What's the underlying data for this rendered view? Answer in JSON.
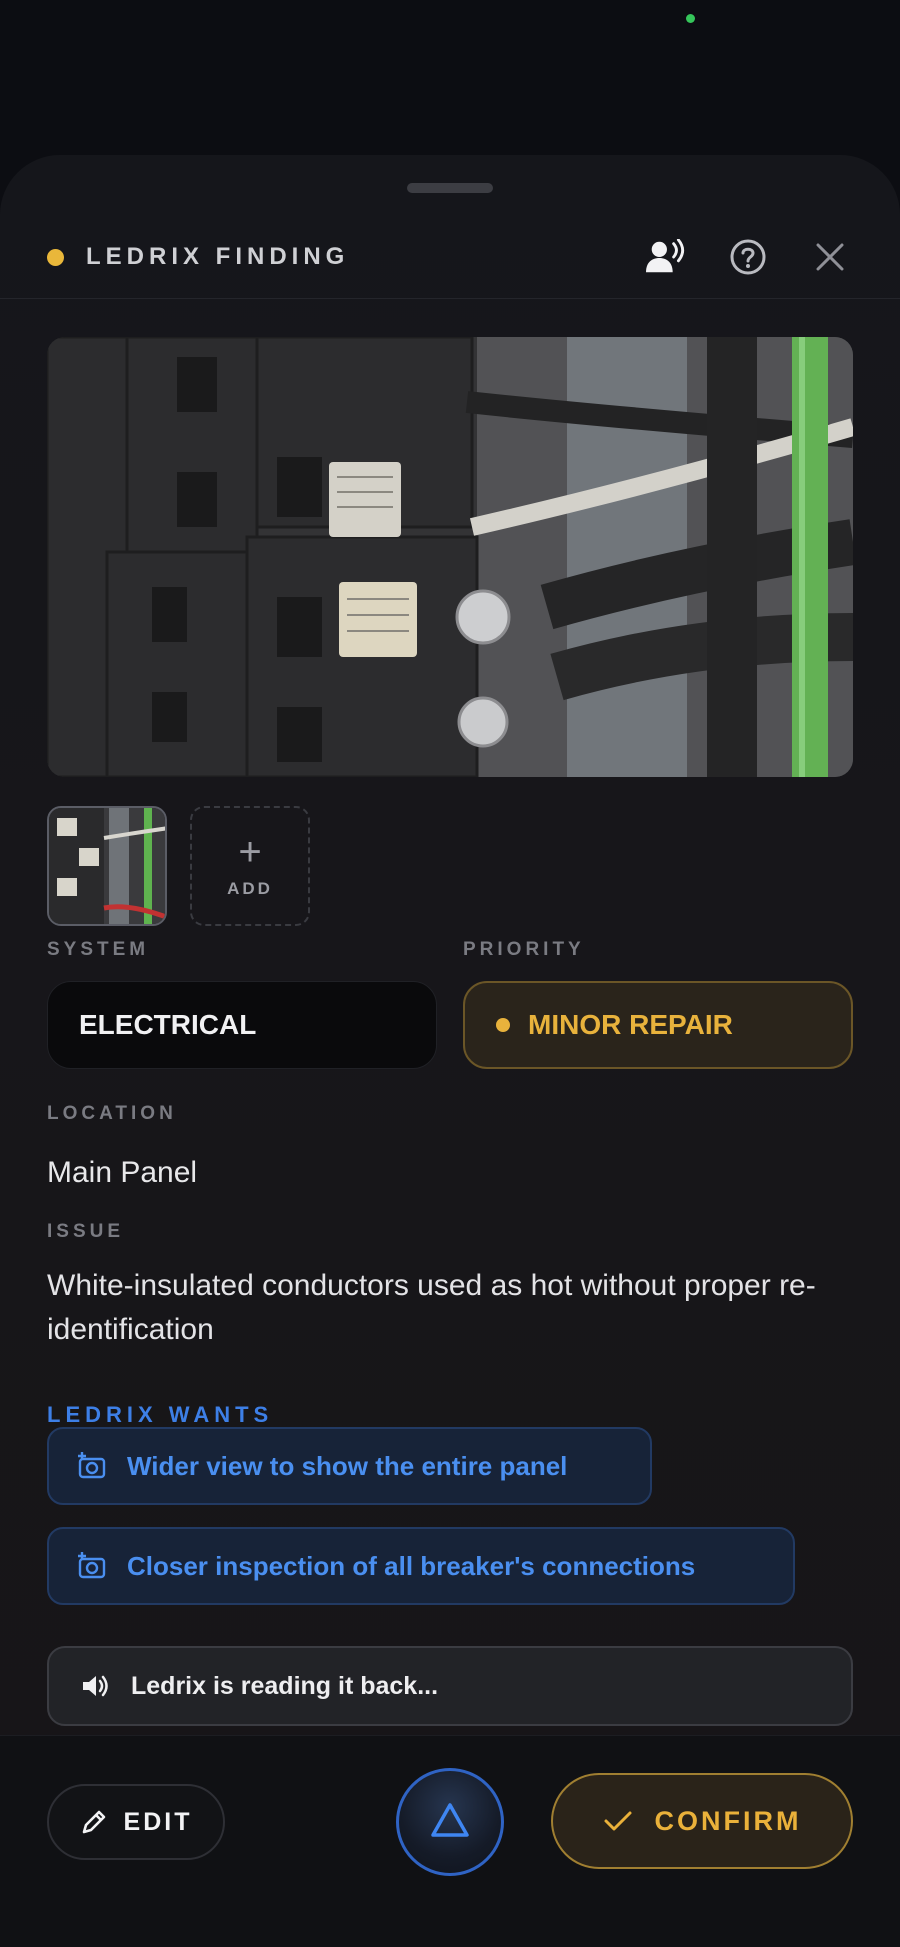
{
  "header": {
    "title": "LEDRIX FINDING",
    "status_color": "#e9b73a"
  },
  "photos": {
    "add_label": "ADD",
    "add_icon": "plus-icon"
  },
  "fields": {
    "system_label": "SYSTEM",
    "system_value": "ELECTRICAL",
    "priority_label": "PRIORITY",
    "priority_value": "MINOR REPAIR",
    "priority_color": "#e8b23c",
    "location_label": "LOCATION",
    "location_value": "Main Panel",
    "issue_label": "ISSUE",
    "issue_value": "White-insulated conductors used as hot without proper re-identification"
  },
  "wants": {
    "label": "LEDRIX WANTS",
    "items": [
      {
        "label": "Wider view to show the entire panel",
        "icon": "camera-add-icon"
      },
      {
        "label": "Closer inspection of all breaker's connections",
        "icon": "camera-add-icon"
      }
    ],
    "accent_color": "#4a8ff0"
  },
  "readback": {
    "text": "Ledrix is reading it back...",
    "icon": "speaker-icon"
  },
  "actions": {
    "edit_label": "EDIT",
    "confirm_label": "CONFIRM",
    "confirm_color": "#eab13a"
  }
}
